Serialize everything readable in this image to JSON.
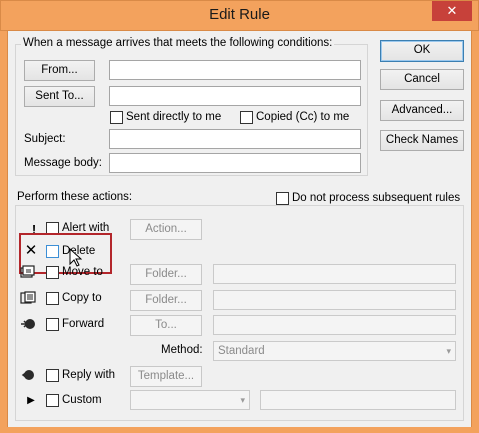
{
  "window": {
    "title": "Edit Rule",
    "close_glyph": "✕"
  },
  "conditions": {
    "legend": "When a message arrives that meets the following conditions:",
    "from_button": "From...",
    "sent_to_button": "Sent To...",
    "sent_directly_label": "Sent directly to me",
    "copied_label": "Copied (Cc) to me",
    "subject_label": "Subject:",
    "body_label": "Message body:"
  },
  "side_buttons": {
    "ok": "OK",
    "cancel": "Cancel",
    "advanced": "Advanced...",
    "check_names": "Check Names"
  },
  "actions": {
    "legend": "Perform these actions:",
    "do_not_process": "Do not process subsequent rules",
    "alert_label": "Alert with",
    "alert_button": "Action...",
    "delete_label": "Delete",
    "move_label": "Move to",
    "move_button": "Folder...",
    "copy_label": "Copy to",
    "copy_button": "Folder...",
    "forward_label": "Forward",
    "forward_button": "To...",
    "method_label": "Method:",
    "method_value": "Standard",
    "reply_label": "Reply with",
    "reply_button": "Template...",
    "custom_label": "Custom"
  },
  "icons": {
    "alert": "!",
    "delete": "✕",
    "custom": "▶",
    "dropdown": "▾"
  },
  "colors": {
    "title_bar": "#f3a25d",
    "close": "#c7413a",
    "highlight": "#b3262b"
  }
}
